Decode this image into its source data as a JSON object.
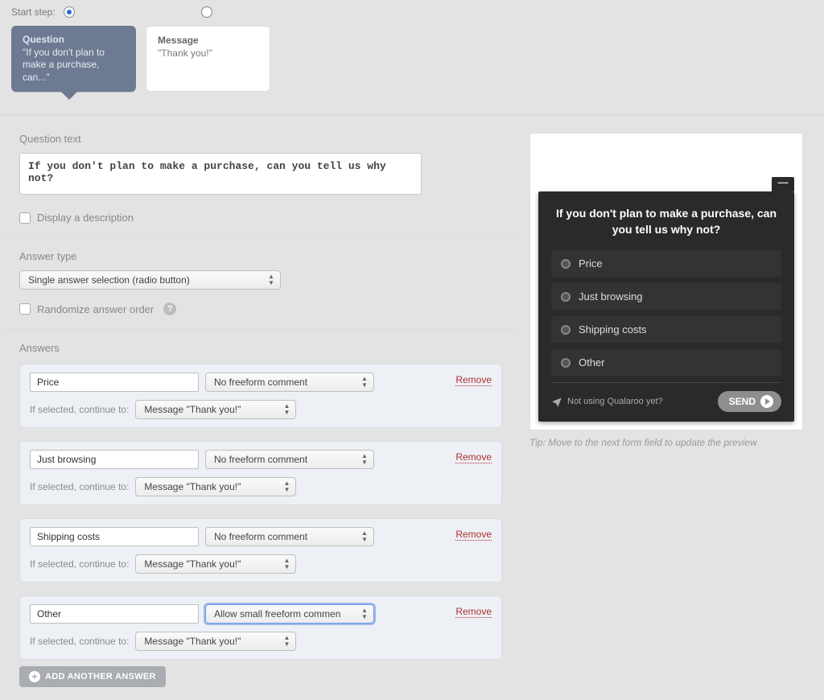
{
  "topbar": {
    "start_step_label": "Start step:"
  },
  "steps": {
    "question_title": "Question",
    "question_preview": "\"If you don't plan to make a purchase, can...\"",
    "message_title": "Message",
    "message_preview": "\"Thank you!\""
  },
  "sections": {
    "question_text_label": "Question text",
    "question_value": "If you don't plan to make a purchase, can you tell us why not?",
    "display_description_label": "Display a description",
    "answer_type_label": "Answer type",
    "answer_type_value": "Single answer selection (radio button)",
    "randomize_label": "Randomize answer order",
    "answers_label": "Answers",
    "if_selected_label": "If selected, continue to:",
    "remove_label": "Remove",
    "add_answer_label": "ADD ANOTHER ANSWER"
  },
  "freeform": {
    "none": "No freeform comment",
    "small": "Allow small freeform commen"
  },
  "continue_option": "Message \"Thank you!\"",
  "answers": [
    {
      "text": "Price",
      "freeform": "none",
      "highlight": false
    },
    {
      "text": "Just browsing",
      "freeform": "none",
      "highlight": false
    },
    {
      "text": "Shipping costs",
      "freeform": "none",
      "highlight": false
    },
    {
      "text": "Other",
      "freeform": "small",
      "highlight": true
    }
  ],
  "preview": {
    "question": "If you don't plan to make a purchase, can you tell us why not?",
    "options": [
      "Price",
      "Just browsing",
      "Shipping costs",
      "Other"
    ],
    "brand": "Not using Qualaroo yet?",
    "send": "SEND",
    "tip": "Tip: Move to the next form field to update the preview"
  }
}
